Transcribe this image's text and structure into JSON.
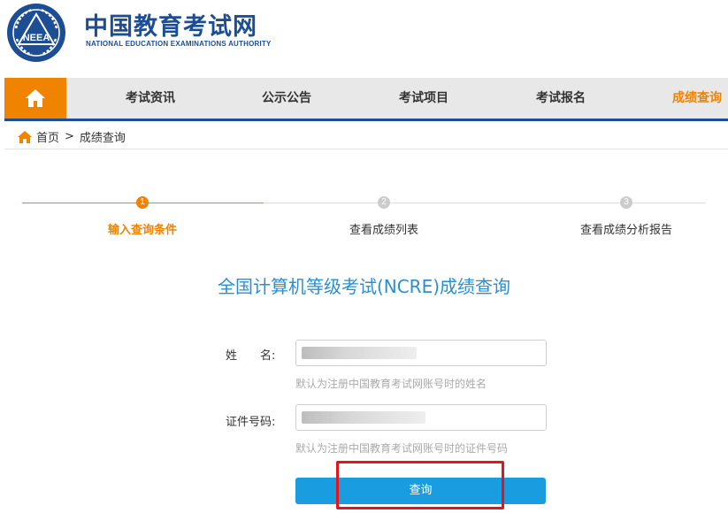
{
  "header": {
    "logo_text": "NEEA",
    "brand_cn": "中国教育考试网",
    "brand_en": "NATIONAL EDUCATION EXAMINATIONS AUTHORITY"
  },
  "nav": {
    "home_icon": "home-icon",
    "items": [
      {
        "label": "考试资讯"
      },
      {
        "label": "公示公告"
      },
      {
        "label": "考试项目"
      },
      {
        "label": "考试报名"
      },
      {
        "label": "成绩查询"
      }
    ],
    "active_color": "#f08300"
  },
  "breadcrumb": {
    "home": "首页",
    "separator": ">",
    "current": "成绩查询"
  },
  "steps": [
    {
      "number": "1",
      "label": "输入查询条件",
      "active": true
    },
    {
      "number": "2",
      "label": "查看成绩列表",
      "active": false
    },
    {
      "number": "3",
      "label": "查看成绩分析报告",
      "active": false
    }
  ],
  "title": "全国计算机等级考试(NCRE)成绩查询",
  "form": {
    "name_label": "姓　　名:",
    "name_hint": "默认为注册中国教育考试网账号时的姓名",
    "id_label": "证件号码:",
    "id_hint": "默认为注册中国教育考试网账号时的证件号码",
    "submit_label": "查询"
  },
  "colors": {
    "brand_blue": "#1d4e93",
    "accent_orange": "#f08300",
    "button_blue": "#1a9de0",
    "highlight_red": "#e3141b"
  }
}
